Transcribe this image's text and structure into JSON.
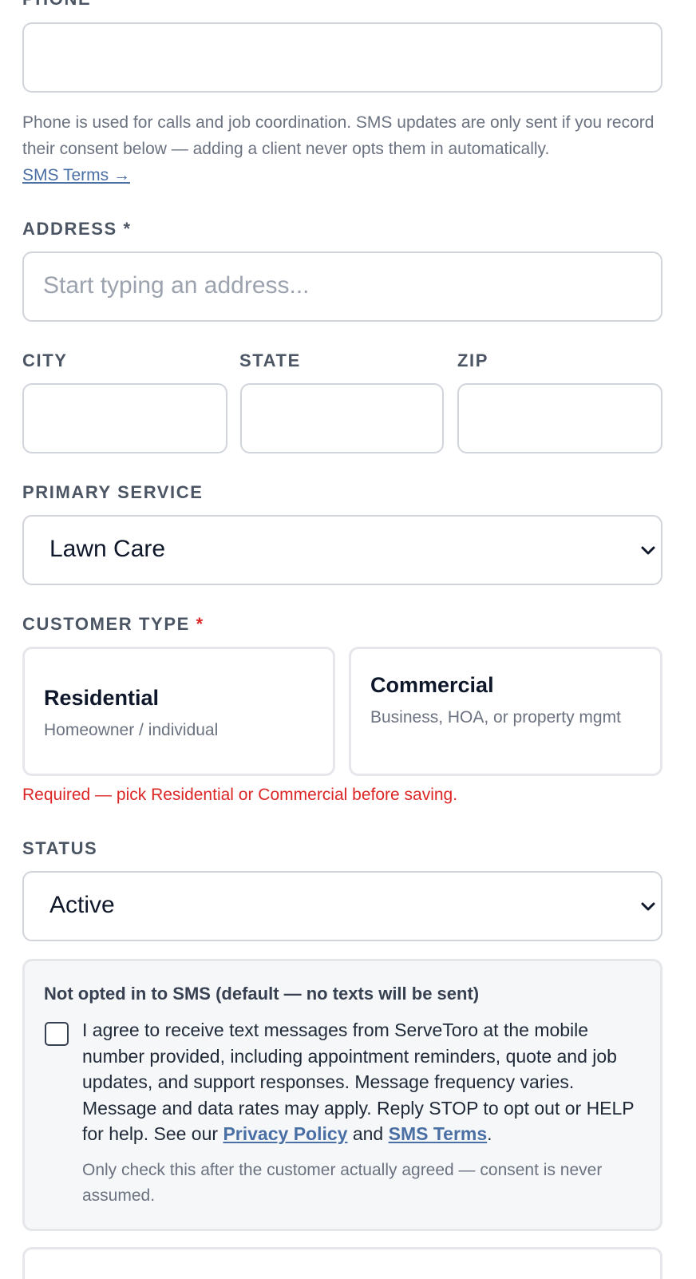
{
  "phone": {
    "label": "PHONE *",
    "value": "",
    "help": "Phone is used for calls and job coordination. SMS updates are only sent if you record their consent below — adding a client never opts them in automatically.",
    "sms_terms_link": "SMS Terms →"
  },
  "address": {
    "label": "ADDRESS *",
    "placeholder": "Start typing an address..."
  },
  "city": {
    "label": "CITY",
    "value": ""
  },
  "state": {
    "label": "STATE",
    "value": ""
  },
  "zip": {
    "label": "ZIP",
    "value": ""
  },
  "primary_service": {
    "label": "PRIMARY SERVICE",
    "selected": "Lawn Care"
  },
  "customer_type": {
    "label": "CUSTOMER TYPE",
    "required_mark": "*",
    "options": [
      {
        "title": "Residential",
        "description": "Homeowner / individual"
      },
      {
        "title": "Commercial",
        "description": "Business, HOA, or property mgmt"
      }
    ],
    "error": "Required — pick Residential or Commercial before saving."
  },
  "status": {
    "label": "STATUS",
    "selected": "Active"
  },
  "sms_consent": {
    "heading": "Not opted in to SMS (default — no texts will be sent)",
    "checked": false,
    "agreement_text": "I agree to receive text messages from ServeToro at the mobile number provided, including appointment reminders, quote and job updates, and support responses. Message frequency varies. Message and data rates may apply. Reply STOP to opt out or HELP for help. See our",
    "privacy_link": "Privacy Policy",
    "and_text": "and",
    "sms_terms_link": "SMS Terms",
    "end_punct": ".",
    "note": "Only check this after the customer actually agreed — consent is never assumed."
  },
  "colors": {
    "link": "#4a6fa5",
    "error": "#dc2626",
    "border": "#d1d5db",
    "label": "#4b5563"
  }
}
